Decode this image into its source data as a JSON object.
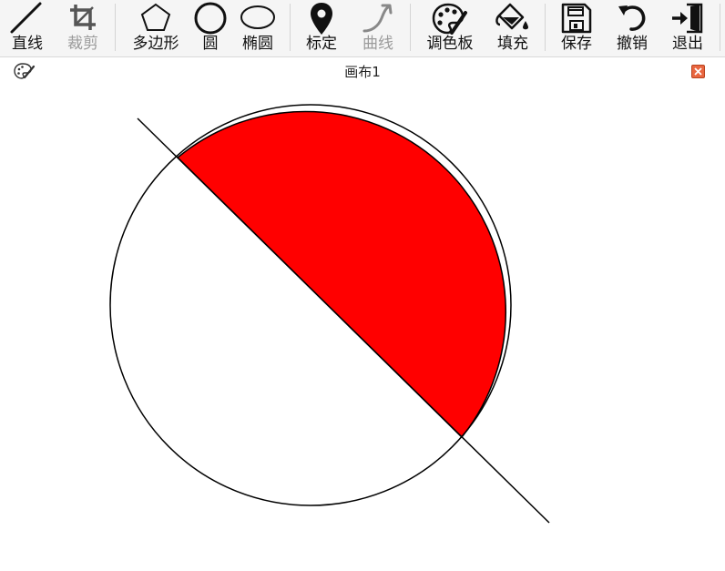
{
  "toolbar": {
    "tools": [
      {
        "id": "line",
        "label": "直线",
        "icon": "line-icon",
        "enabled": true
      },
      {
        "id": "crop",
        "label": "裁剪",
        "icon": "crop-icon",
        "enabled": false
      },
      {
        "id": "polygon",
        "label": "多边形",
        "icon": "pentagon-icon",
        "enabled": true
      },
      {
        "id": "circle",
        "label": "圆",
        "icon": "circle-icon",
        "enabled": true
      },
      {
        "id": "ellipse",
        "label": "椭圆",
        "icon": "ellipse-icon",
        "enabled": true
      },
      {
        "id": "mark",
        "label": "标定",
        "icon": "map-pin-icon",
        "enabled": true
      },
      {
        "id": "curve",
        "label": "曲线",
        "icon": "curve-arrow-icon",
        "enabled": false
      },
      {
        "id": "palette",
        "label": "调色板",
        "icon": "palette-icon",
        "enabled": true
      },
      {
        "id": "fill",
        "label": "填充",
        "icon": "paint-bucket-icon",
        "enabled": true
      },
      {
        "id": "save",
        "label": "保存",
        "icon": "floppy-disk-icon",
        "enabled": true
      },
      {
        "id": "undo",
        "label": "撤销",
        "icon": "undo-icon",
        "enabled": true
      },
      {
        "id": "exit",
        "label": "退出",
        "icon": "exit-door-icon",
        "enabled": true
      }
    ]
  },
  "canvas_window": {
    "title": "画布1",
    "app_icon": "palette-icon",
    "close_icon": "close-icon"
  },
  "drawing": {
    "stroke_color": "#000000",
    "fill_color": "#ff0000",
    "background_color": "#ffffff"
  }
}
